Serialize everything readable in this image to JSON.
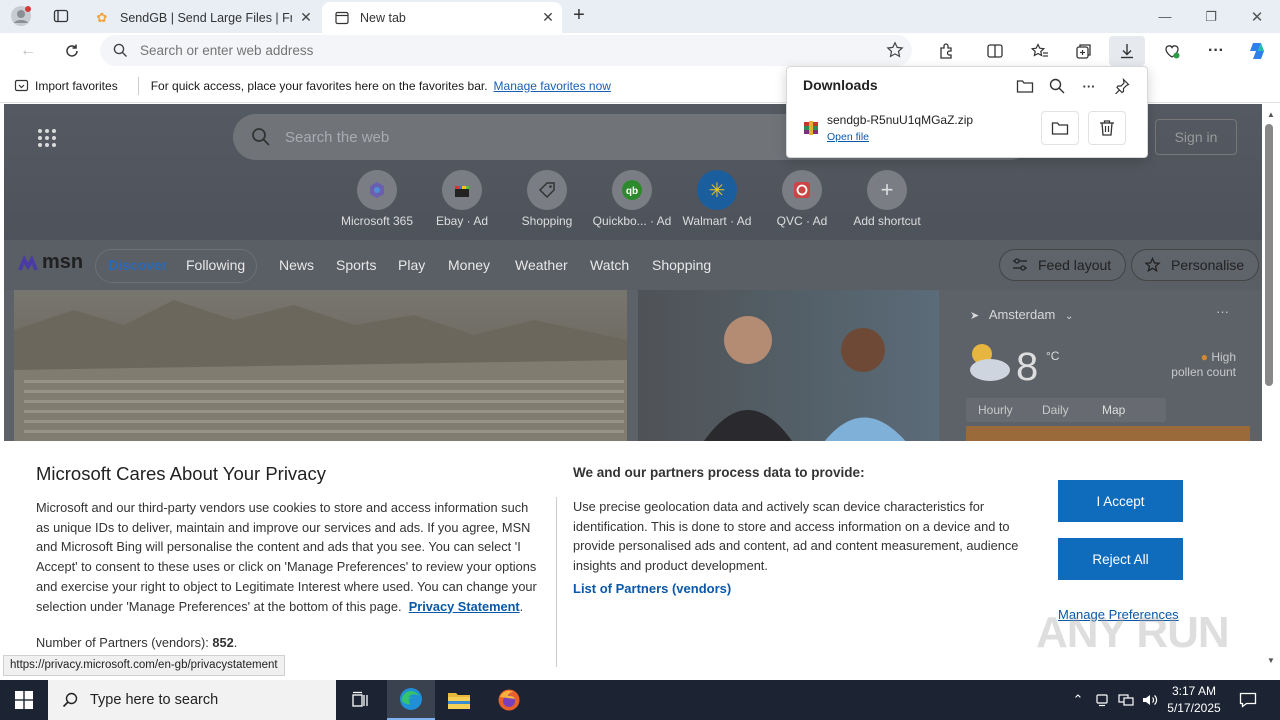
{
  "browser": {
    "tabs": [
      {
        "title": "SendGB | Send Large Files | Free f",
        "active": false
      },
      {
        "title": "New tab",
        "active": true
      }
    ],
    "address_placeholder": "Search or enter web address"
  },
  "favorites_bar": {
    "import_label": "Import favorites",
    "hint": "For quick access, place your favorites here on the favorites bar.",
    "manage_link": "Manage favorites now"
  },
  "downloads": {
    "title": "Downloads",
    "items": [
      {
        "filename": "sendgb-R5nuU1qMGaZ.zip",
        "action": "Open file"
      }
    ]
  },
  "msn": {
    "search_placeholder": "Search the web",
    "signin": "Sign in",
    "shortcuts": [
      {
        "label": "Microsoft 365"
      },
      {
        "label": "Ebay · Ad"
      },
      {
        "label": "Shopping"
      },
      {
        "label": "Quickbo... · Ad"
      },
      {
        "label": "Walmart · Ad"
      },
      {
        "label": "QVC · Ad"
      },
      {
        "label": "Add shortcut"
      }
    ],
    "logo": "msn",
    "nav": [
      "Discover",
      "Following",
      "News",
      "Sports",
      "Play",
      "Money",
      "Weather",
      "Watch",
      "Shopping"
    ],
    "feed_layout": "Feed layout",
    "personalise": "Personalise",
    "weather": {
      "location": "Amsterdam",
      "temp": "8",
      "unit": "°C",
      "pollen_line1": "High",
      "pollen_line2": "pollen count",
      "tabs": [
        "Hourly",
        "Daily",
        "Map"
      ]
    }
  },
  "privacy": {
    "title": "Microsoft Cares About Your Privacy",
    "body": "Microsoft and our third-party vendors use cookies to store and access information such as unique IDs to deliver, maintain and improve our services and ads. If you agree, MSN and Microsoft Bing will personalise the content and ads that you see. You can select 'I Accept' to consent to these uses or click on 'Manage Preferences' to review your options and exercise your right to object to Legitimate Interest where used.  You can change your selection under 'Manage Preferences' at the bottom of this page.",
    "privacy_link": "Privacy Statement",
    "partners_label": "Number of Partners (vendors):",
    "partners_count": "852",
    "heading2": "We and our partners process data to provide:",
    "body2": "Use precise geolocation data and actively scan device characteristics for identification. This is done to store and access information on a device and to provide personalised ads and content, ad and content measurement, audience insights and product development.",
    "list_link": "List of Partners (vendors)",
    "accept": "I Accept",
    "reject": "Reject All",
    "manage": "Manage Preferences"
  },
  "status_url": "https://privacy.microsoft.com/en-gb/privacystatement",
  "watermark": "ANY RUN",
  "taskbar": {
    "search_placeholder": "Type here to search",
    "time": "3:17 AM",
    "date": "5/17/2025"
  },
  "colors": {
    "accent_blue": "#0f6cbd",
    "link_blue": "#0a58a8",
    "taskbar": "#1c2433"
  }
}
